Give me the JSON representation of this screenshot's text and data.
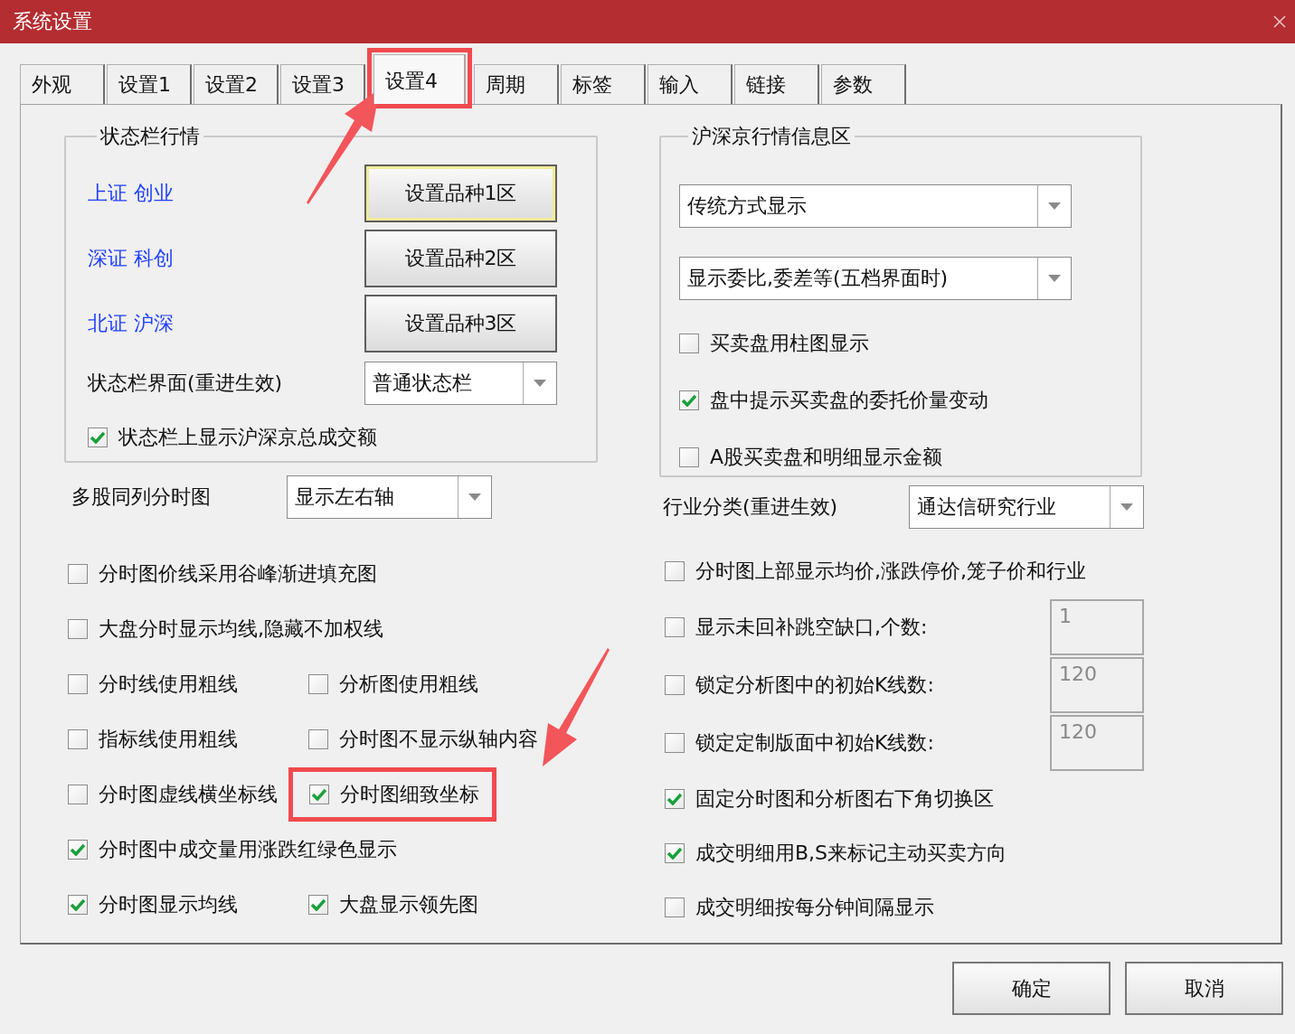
{
  "window": {
    "title": "系统设置"
  },
  "tabs": [
    {
      "label": "外观",
      "selected": false,
      "highlighted": false
    },
    {
      "label": "设置1",
      "selected": false,
      "highlighted": false
    },
    {
      "label": "设置2",
      "selected": false,
      "highlighted": false
    },
    {
      "label": "设置3",
      "selected": false,
      "highlighted": false
    },
    {
      "label": "设置4",
      "selected": true,
      "highlighted": true
    },
    {
      "label": "周期",
      "selected": false,
      "highlighted": false
    },
    {
      "label": "标签",
      "selected": false,
      "highlighted": false
    },
    {
      "label": "输入",
      "selected": false,
      "highlighted": false
    },
    {
      "label": "链接",
      "selected": false,
      "highlighted": false
    },
    {
      "label": "参数",
      "selected": false,
      "highlighted": false
    }
  ],
  "status_group": {
    "title": "状态栏行情",
    "rows": [
      {
        "link": "上证 创业",
        "button": "设置品种1区",
        "focused": true
      },
      {
        "link": "深证 科创",
        "button": "设置品种2区",
        "focused": false
      },
      {
        "link": "北证 沪深",
        "button": "设置品种3区",
        "focused": false
      }
    ],
    "combo_label": "状态栏界面(重进生效)",
    "combo_value": "普通状态栏",
    "option": {
      "label": "状态栏上显示沪深京总成交额",
      "checked": true
    }
  },
  "multi_chart": {
    "label": "多股同列分时图",
    "value": "显示左右轴"
  },
  "left_options": [
    {
      "items": [
        {
          "label": "分时图价线采用谷峰渐进填充图",
          "checked": false,
          "highlighted": false
        }
      ]
    },
    {
      "items": [
        {
          "label": "大盘分时显示均线,隐藏不加权线",
          "checked": false,
          "highlighted": false
        }
      ]
    },
    {
      "items": [
        {
          "label": "分时线使用粗线",
          "checked": false,
          "highlighted": false
        },
        {
          "label": "分析图使用粗线",
          "checked": false,
          "highlighted": false
        }
      ]
    },
    {
      "items": [
        {
          "label": "指标线使用粗线",
          "checked": false,
          "highlighted": false
        },
        {
          "label": "分时图不显示纵轴内容",
          "checked": false,
          "highlighted": false
        }
      ]
    },
    {
      "items": [
        {
          "label": "分时图虚线横坐标线",
          "checked": false,
          "highlighted": false
        },
        {
          "label": "分时图细致坐标",
          "checked": true,
          "highlighted": true
        }
      ]
    },
    {
      "items": [
        {
          "label": "分时图中成交量用涨跌红绿色显示",
          "checked": true,
          "highlighted": false
        }
      ]
    },
    {
      "items": [
        {
          "label": "分时图显示均线",
          "checked": true,
          "highlighted": false
        },
        {
          "label": "大盘显示领先图",
          "checked": true,
          "highlighted": false
        }
      ]
    }
  ],
  "quote_group": {
    "title": "沪深京行情信息区",
    "combos": [
      "传统方式显示",
      "显示委比,委差等(五档界面时)"
    ],
    "options": [
      {
        "label": "买卖盘用柱图显示",
        "checked": false
      },
      {
        "label": "盘中提示买卖盘的委托价量变动",
        "checked": true
      },
      {
        "label": "A股买卖盘和明细显示金额",
        "checked": false
      }
    ]
  },
  "industry": {
    "label": "行业分类(重进生效)",
    "value": "通达信研究行业"
  },
  "right_options": [
    {
      "kind": "check",
      "label": "分时图上部显示均价,涨跌停价,笼子价和行业",
      "checked": false
    },
    {
      "kind": "check-number",
      "label": "显示未回补跳空缺口,个数:",
      "checked": false,
      "value": "1",
      "disabled": true
    },
    {
      "kind": "check-number",
      "label": "锁定分析图中的初始K线数:",
      "checked": false,
      "value": "120",
      "disabled": true
    },
    {
      "kind": "check-number",
      "label": "锁定定制版面中初始K线数:",
      "checked": false,
      "value": "120",
      "disabled": true
    },
    {
      "kind": "check",
      "label": "固定分时图和分析图右下角切换区",
      "checked": true
    },
    {
      "kind": "check",
      "label": "成交明细用B,S来标记主动买卖方向",
      "checked": true
    },
    {
      "kind": "check",
      "label": "成交明细按每分钟间隔显示",
      "checked": false
    }
  ],
  "buttons": [
    "确定",
    "取消"
  ]
}
